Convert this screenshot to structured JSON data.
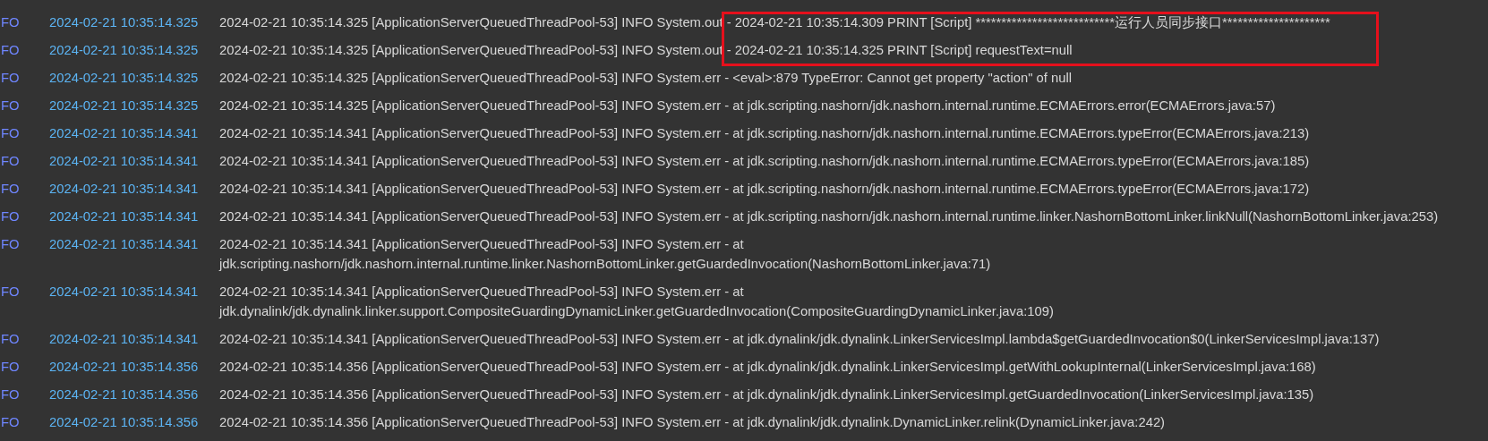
{
  "log": {
    "rows": [
      {
        "level": "FO",
        "time": "2024-02-21 10:35:14.325",
        "message": "2024-02-21 10:35:14.325 [ApplicationServerQueuedThreadPool-53] INFO System.out - 2024-02-21 10:35:14.309 PRINT [Script] ***************************运行人员同步接口*********************"
      },
      {
        "level": "FO",
        "time": "2024-02-21 10:35:14.325",
        "message": "2024-02-21 10:35:14.325 [ApplicationServerQueuedThreadPool-53] INFO System.out - 2024-02-21 10:35:14.325 PRINT [Script] requestText=null"
      },
      {
        "level": "FO",
        "time": "2024-02-21 10:35:14.325",
        "message": "2024-02-21 10:35:14.325 [ApplicationServerQueuedThreadPool-53] INFO System.err - <eval>:879 TypeError: Cannot get property \"action\" of null"
      },
      {
        "level": "FO",
        "time": "2024-02-21 10:35:14.325",
        "message": "2024-02-21 10:35:14.325 [ApplicationServerQueuedThreadPool-53] INFO System.err - at jdk.scripting.nashorn/jdk.nashorn.internal.runtime.ECMAErrors.error(ECMAErrors.java:57)"
      },
      {
        "level": "FO",
        "time": "2024-02-21 10:35:14.341",
        "message": "2024-02-21 10:35:14.341 [ApplicationServerQueuedThreadPool-53] INFO System.err - at jdk.scripting.nashorn/jdk.nashorn.internal.runtime.ECMAErrors.typeError(ECMAErrors.java:213)"
      },
      {
        "level": "FO",
        "time": "2024-02-21 10:35:14.341",
        "message": "2024-02-21 10:35:14.341 [ApplicationServerQueuedThreadPool-53] INFO System.err - at jdk.scripting.nashorn/jdk.nashorn.internal.runtime.ECMAErrors.typeError(ECMAErrors.java:185)"
      },
      {
        "level": "FO",
        "time": "2024-02-21 10:35:14.341",
        "message": "2024-02-21 10:35:14.341 [ApplicationServerQueuedThreadPool-53] INFO System.err - at jdk.scripting.nashorn/jdk.nashorn.internal.runtime.ECMAErrors.typeError(ECMAErrors.java:172)"
      },
      {
        "level": "FO",
        "time": "2024-02-21 10:35:14.341",
        "message": "2024-02-21 10:35:14.341 [ApplicationServerQueuedThreadPool-53] INFO System.err - at jdk.scripting.nashorn/jdk.nashorn.internal.runtime.linker.NashornBottomLinker.linkNull(NashornBottomLinker.java:253)"
      },
      {
        "level": "FO",
        "time": "2024-02-21 10:35:14.341",
        "message": "2024-02-21 10:35:14.341 [ApplicationServerQueuedThreadPool-53] INFO System.err - at jdk.scripting.nashorn/jdk.nashorn.internal.runtime.linker.NashornBottomLinker.getGuardedInvocation(NashornBottomLinker.java:71)"
      },
      {
        "level": "FO",
        "time": "2024-02-21 10:35:14.341",
        "message": "2024-02-21 10:35:14.341 [ApplicationServerQueuedThreadPool-53] INFO System.err - at jdk.dynalink/jdk.dynalink.linker.support.CompositeGuardingDynamicLinker.getGuardedInvocation(CompositeGuardingDynamicLinker.java:109)"
      },
      {
        "level": "FO",
        "time": "2024-02-21 10:35:14.341",
        "message": "2024-02-21 10:35:14.341 [ApplicationServerQueuedThreadPool-53] INFO System.err - at jdk.dynalink/jdk.dynalink.LinkerServicesImpl.lambda$getGuardedInvocation$0(LinkerServicesImpl.java:137)"
      },
      {
        "level": "FO",
        "time": "2024-02-21 10:35:14.356",
        "message": "2024-02-21 10:35:14.356 [ApplicationServerQueuedThreadPool-53] INFO System.err - at jdk.dynalink/jdk.dynalink.LinkerServicesImpl.getWithLookupInternal(LinkerServicesImpl.java:168)"
      },
      {
        "level": "FO",
        "time": "2024-02-21 10:35:14.356",
        "message": "2024-02-21 10:35:14.356 [ApplicationServerQueuedThreadPool-53] INFO System.err - at jdk.dynalink/jdk.dynalink.LinkerServicesImpl.getGuardedInvocation(LinkerServicesImpl.java:135)"
      },
      {
        "level": "FO",
        "time": "2024-02-21 10:35:14.356",
        "message": "2024-02-21 10:35:14.356 [ApplicationServerQueuedThreadPool-53] INFO System.err - at jdk.dynalink/jdk.dynalink.DynamicLinker.relink(DynamicLinker.java:242)"
      }
    ]
  }
}
